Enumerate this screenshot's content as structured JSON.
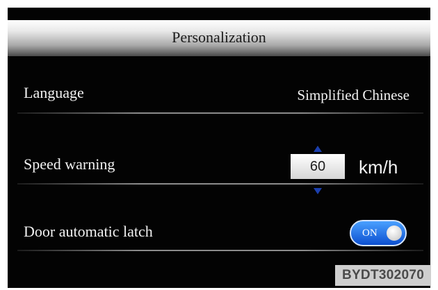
{
  "header": {
    "title": "Personalization"
  },
  "settings": {
    "language": {
      "label": "Language",
      "value": "Simplified Chinese"
    },
    "speed_warning": {
      "label": "Speed warning",
      "value": "60",
      "unit": "km/h"
    },
    "door_latch": {
      "label": "Door automatic latch",
      "state": "ON"
    }
  },
  "watermark": "BYDT302070",
  "colors": {
    "background": "#030303",
    "toggle_on": "#1a6ef5",
    "stepper_arrow": "#1b3fae"
  }
}
